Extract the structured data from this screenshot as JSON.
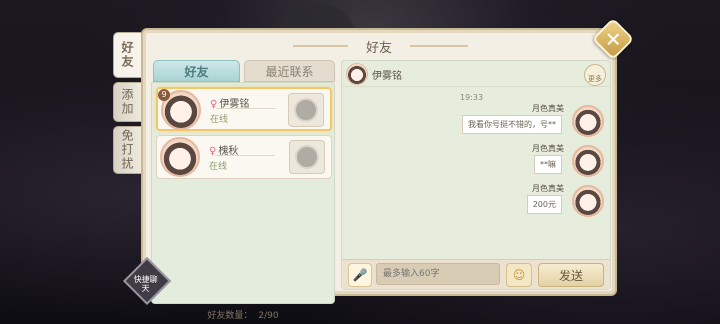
{
  "side_tabs": [
    {
      "label": "好友",
      "active": true
    },
    {
      "label": "添加",
      "active": false
    },
    {
      "label": "免打扰",
      "active": false
    }
  ],
  "panel": {
    "title": "好友"
  },
  "friend_tabs": {
    "friends": "好友",
    "recent": "最近联系"
  },
  "friends": [
    {
      "name": "伊雾铭",
      "status": "在线",
      "level": "9",
      "selected": true
    },
    {
      "name": "槐秋",
      "status": "在线",
      "level": "",
      "selected": false
    }
  ],
  "friend_count": {
    "label": "好友数量：",
    "value": "2/90"
  },
  "chat": {
    "contact_name": "伊雾铭",
    "more_label": "更多",
    "timestamp": "19:33",
    "messages": [
      {
        "sender": "月色真美",
        "text": "我看你号挺不错的，号**"
      },
      {
        "sender": "月色真美",
        "text": "**嘛"
      },
      {
        "sender": "月色真美",
        "text": "200元"
      }
    ],
    "input_placeholder": "最多输入60字",
    "send_label": "发送"
  },
  "quick_chat_label": "快捷聊天",
  "colors": {
    "accent": "#a9d3d4",
    "gold": "#c59a45",
    "online": "#8d9d6c"
  },
  "icons": {
    "close": "close-icon",
    "mic": "microphone-icon",
    "emoji": "emoji-icon",
    "gift": "gift-icon"
  }
}
